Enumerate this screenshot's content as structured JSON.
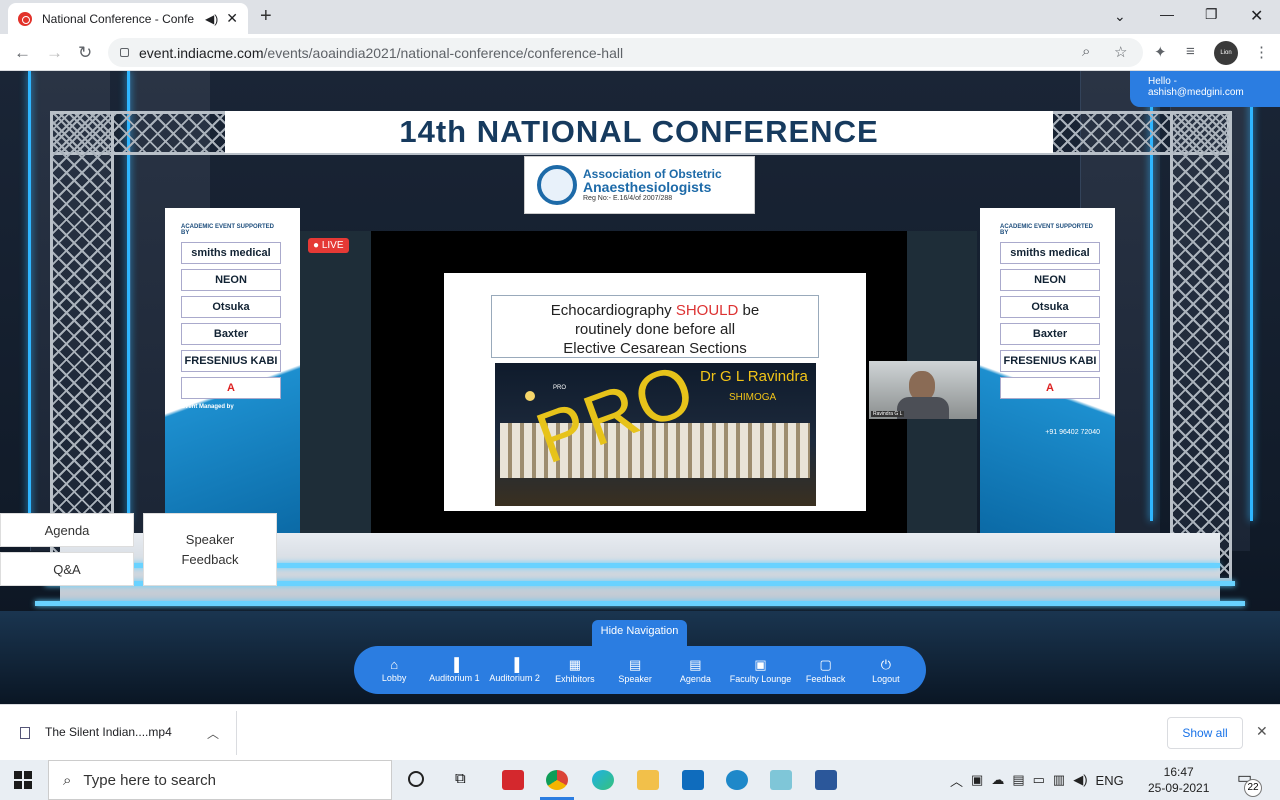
{
  "browser": {
    "tab_title": "National Conference - Confe",
    "new_tab": "+",
    "url_host": "event.indiacme.com",
    "url_path": "/events/aoaindia2021/national-conference/conference-hall",
    "profile_text": "Lion Truth"
  },
  "page": {
    "hello_label": "Hello -",
    "hello_email": "ashish@medgini.com",
    "banner_title": "14th NATIONAL CONFERENCE",
    "logo": {
      "line1": "Association of Obstetric",
      "line2": "Anaesthesiologists",
      "line3": "Reg No:- E.16/4/of 2007/288"
    },
    "live_badge": "LIVE",
    "slide": {
      "title_pre": "Echocardiography ",
      "title_emph": "SHOULD",
      "title_post": " be",
      "line2": "routinely done before all",
      "line3": "Elective Cesarean Sections",
      "stamp": "PRO",
      "speaker": "Dr G L Ravindra",
      "place": "SHIMOGA",
      "small_tag": "PRO"
    },
    "camera_label": "Ravindra G L",
    "side_panel": {
      "header": "ACADEMIC EVENT SUPPORTED BY",
      "sponsors": [
        "smiths medical",
        "NEON",
        "Otsuka",
        "Baxter",
        "FRESENIUS KABI",
        "A"
      ],
      "managed_by": "Event Managed by",
      "phone": "+91 96402 72040"
    },
    "left_buttons": {
      "agenda": "Agenda",
      "qa": "Q&A",
      "speaker_feedback_1": "Speaker",
      "speaker_feedback_2": "Feedback"
    },
    "hide_navigation": "Hide Navigation",
    "nav": [
      {
        "label": "Lobby",
        "icon": "home-icon",
        "glyph": "⌂"
      },
      {
        "label": "Auditorium 1",
        "icon": "auditorium-icon",
        "glyph": "▐"
      },
      {
        "label": "Auditorium 2",
        "icon": "auditorium-icon",
        "glyph": "▐"
      },
      {
        "label": "Exhibitors",
        "icon": "exhibitors-icon",
        "glyph": "▦"
      },
      {
        "label": "Speaker",
        "icon": "document-icon",
        "glyph": "▤"
      },
      {
        "label": "Agenda",
        "icon": "document-icon",
        "glyph": "▤"
      },
      {
        "label": "Faculty Lounge",
        "icon": "lounge-icon",
        "glyph": "▣"
      },
      {
        "label": "Feedback",
        "icon": "feedback-icon",
        "glyph": "▢"
      },
      {
        "label": "Logout",
        "icon": "power-icon",
        "glyph": "⏻"
      }
    ]
  },
  "download_bar": {
    "file": "The Silent Indian....mp4",
    "show_all": "Show all"
  },
  "taskbar": {
    "search_placeholder": "Type here to search",
    "lang": "ENG",
    "time": "16:47",
    "date": "25-09-2021",
    "notifications": "22"
  },
  "colors": {
    "accent": "#2b7de1",
    "live": "#e53935",
    "banner_text": "#163a5e",
    "slide_highlight": "#f2c418"
  }
}
